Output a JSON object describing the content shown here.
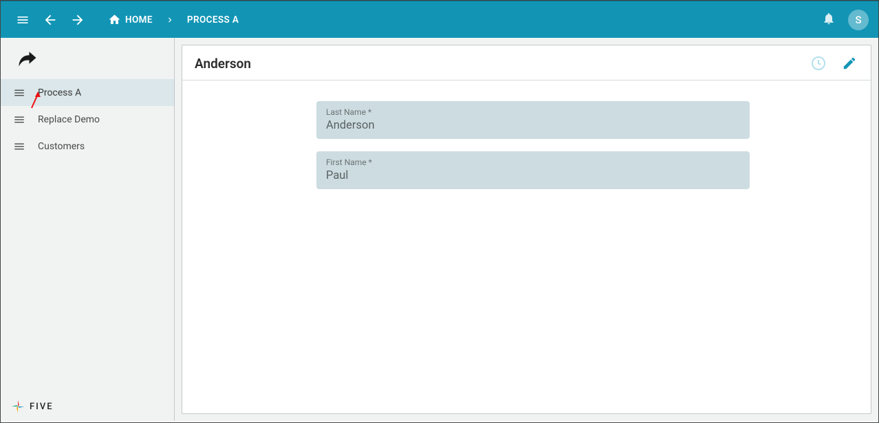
{
  "header": {
    "home_label": "HOME",
    "breadcrumb_current": "PROCESS A",
    "avatar_initial": "S"
  },
  "sidebar": {
    "items": [
      {
        "label": "Process A",
        "selected": true
      },
      {
        "label": "Replace Demo",
        "selected": false
      },
      {
        "label": "Customers",
        "selected": false
      }
    ],
    "brand_text": "FIVE"
  },
  "record": {
    "title": "Anderson",
    "fields": [
      {
        "label": "Last Name *",
        "value": "Anderson"
      },
      {
        "label": "First Name *",
        "value": "Paul"
      }
    ]
  }
}
